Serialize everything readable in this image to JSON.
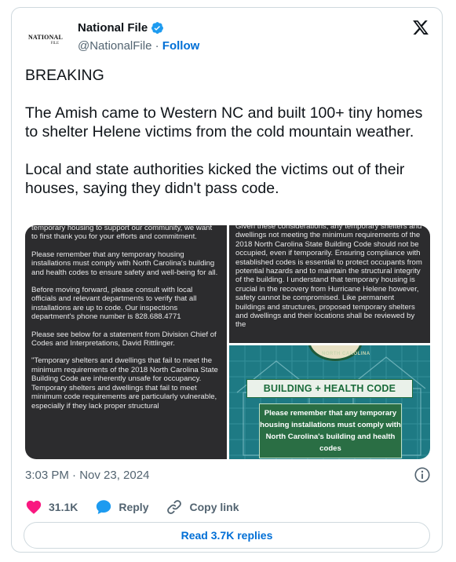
{
  "author": {
    "logo_line1": "NATIONAL",
    "logo_line2": "FILE",
    "name": "National File",
    "handle": "@NationalFile",
    "separator": " · ",
    "follow_label": "Follow"
  },
  "tweet": {
    "text": "BREAKING\n\nThe Amish came to Western NC and built 100+ tiny homes to shelter Helene victims from the cold mountain weather.\n\nLocal and state authorities kicked the victims out of their houses, saying they didn't pass code."
  },
  "media": {
    "left_panel": [
      "temporary housing to support our community, we want to first thank you for your efforts and commitment.",
      "Please remember that any temporary housing installations must comply with North Carolina's building and health codes to ensure safety and well-being for all.",
      "Before moving forward, please consult with local officials and relevant departments to verify that all installations are up to code. Our inspections department's phone number is 828.688.4771",
      "Please see below for a statement from Division Chief of Codes and Interpretations, David  Rittlinger.",
      "\"Temporary shelters and dwellings that fail to meet the minimum requirements of the 2018 North Carolina State Building Code are inherently unsafe for occupancy. Temporary shelters and dwellings that fail to meet minimum code requirements are particularly vulnerable, especially if they lack proper structural"
    ],
    "top_right_panel": "Given these considerations, any temporary shelters and dwellings not meeting the minimum requirements of the 2018 North Carolina State Building Code should not be occupied, even if temporarily. Ensuring compliance with established codes is essential to protect occupants from potential hazards and to maintain the structural integrity of the building. I understand that temporary housing is crucial in the recovery from Hurricane Helene however, safety cannot be compromised. Like permanent buildings and structures, proposed temporary shelters and dwellings and their locations shall be reviewed by the",
    "seal_text": "NORTH CAROLINA",
    "banner_title": "BUILDING + HEALTH CODE",
    "banner_body": "Please remember that any temporary housing installations must comply with North Carolina's building and health codes"
  },
  "timestamp": "3:03 PM · Nov 23, 2024",
  "actions": {
    "like_count": "31.1K",
    "reply_label": "Reply",
    "copy_link_label": "Copy link"
  },
  "read_replies_label": "Read 3.7K replies",
  "colors": {
    "link_blue": "#006fd6",
    "verified_blue": "#1d9bf0",
    "like_pink": "#f91880",
    "muted_gray": "#536471",
    "border": "#cfd9de"
  }
}
